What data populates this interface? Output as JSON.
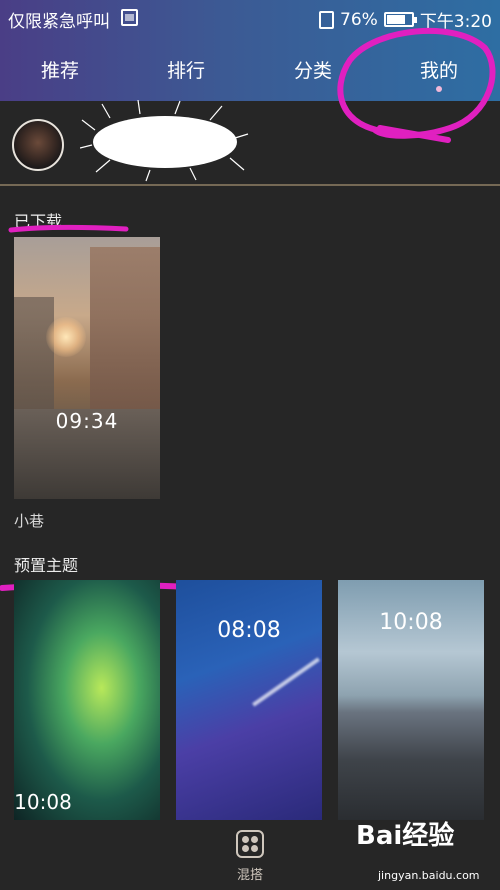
{
  "status_bar": {
    "carrier_text": "仅限紧急呼叫",
    "battery_percent": "76%",
    "battery_level": 0.76,
    "time": "下午3:20"
  },
  "tabs": [
    {
      "label": "推荐"
    },
    {
      "label": "排行"
    },
    {
      "label": "分类"
    },
    {
      "label": "我的",
      "selected": true
    }
  ],
  "sections": {
    "downloaded": {
      "title": "已下载",
      "items": [
        {
          "label": "小巷",
          "preview_time": "09:34"
        }
      ]
    },
    "preset": {
      "title": "预置主题",
      "items": [
        {
          "preview_time": "10:08"
        },
        {
          "preview_time": "08:08"
        },
        {
          "preview_time": "10:08"
        }
      ]
    }
  },
  "bottom_nav": {
    "label": "混搭"
  },
  "watermark": {
    "brand": "Bai经验",
    "url": "jingyan.baidu.com"
  },
  "colors": {
    "header_start": "#4a3e86",
    "header_end": "#2e6ea3",
    "background": "#262626",
    "annotation": "#e020c0"
  },
  "icons": [
    "sim-icon",
    "sim-card-icon",
    "battery-icon",
    "avatar",
    "mix-icon"
  ]
}
